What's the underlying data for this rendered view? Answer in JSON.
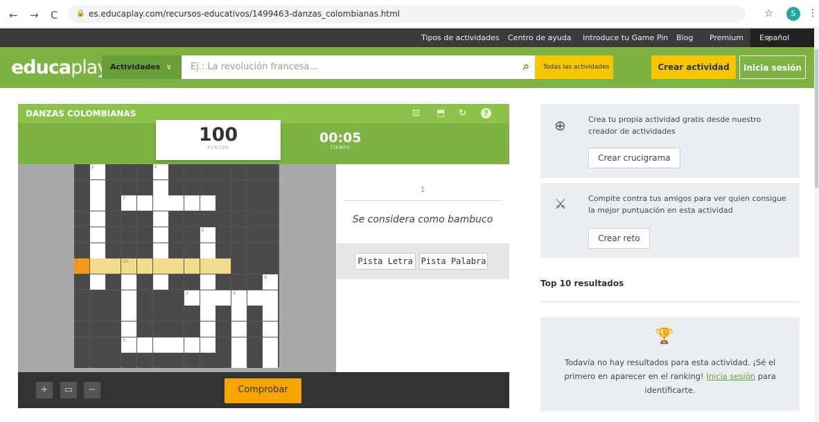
{
  "browser": {
    "back": "←",
    "forward": "→",
    "reload": "C",
    "url": "es.educaplay.com/recursos-educativos/1499463-danzas_colombianas.html",
    "avatar_letter": "S"
  },
  "topbar": {
    "items": [
      "Tipos de actividades",
      "Centro de ayuda",
      "Introduce tu Game Pin",
      "Blog",
      "Premium"
    ],
    "language": "Español"
  },
  "header": {
    "logo_bold": "educa",
    "logo_light": "play",
    "activities": "Actividades",
    "search_placeholder": "Ej.: La revolución francesa...",
    "all_activities": "Todas las actividades",
    "create_activity": "Crear actividad",
    "login": "Inicia sesión"
  },
  "game": {
    "title": "DANZAS COLOMBIANAS",
    "points": "100",
    "points_label": "PUNTOS",
    "time": "00:05",
    "time_label": "TIEMPO",
    "clue_number": "1",
    "clue": "Se considera como bambuco",
    "hint_letter": "Pista Letra",
    "hint_word": "Pista Palabra",
    "check": "Comprobar",
    "zoom_in": "+",
    "zoom_fit": "▭",
    "zoom_out": "−",
    "grid_numbers": [
      {
        "r": 0,
        "c": 1,
        "n": "2"
      },
      {
        "r": 0,
        "c": 5,
        "n": "4"
      },
      {
        "r": 2,
        "c": 3,
        "n": "7"
      },
      {
        "r": 4,
        "c": 8,
        "n": "2"
      },
      {
        "r": 6,
        "c": 0,
        "n": "1"
      },
      {
        "r": 6,
        "c": 3,
        "n": "10"
      },
      {
        "r": 7,
        "c": 12,
        "n": "8"
      },
      {
        "r": 8,
        "c": 7,
        "n": "3"
      },
      {
        "r": 8,
        "c": 10,
        "n": "9"
      },
      {
        "r": 11,
        "c": 3,
        "n": "5"
      }
    ]
  },
  "sidebar": {
    "create_text": "Crea tu propia actividad gratis desde nuestro creador de actividades",
    "create_btn": "Crear crucigrama",
    "challenge_text": "Compite contra tus amigos para ver quien consigue la mejor puntuación en esta actividad",
    "challenge_btn": "Crear reto",
    "top10": "Top 10 resultados",
    "results_pre": "Todavía no hay resultados para esta actividad. ¡Sé el primero en aparecer en el ranking!",
    "results_link": "Inicia sesión",
    "results_post": "para identificarte."
  }
}
